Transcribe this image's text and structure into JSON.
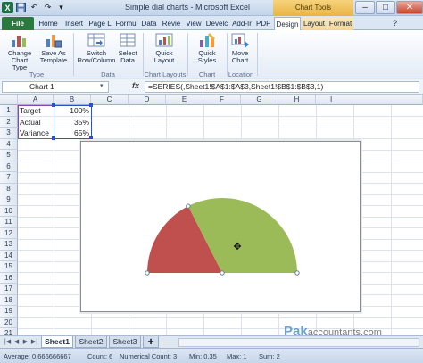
{
  "window": {
    "title": "Simple dial charts - Microsoft Excel",
    "context_group": "Chart Tools",
    "minimize": "–",
    "maximize": "□",
    "close": "✕"
  },
  "tabs": [
    {
      "label": "File"
    },
    {
      "label": "Home"
    },
    {
      "label": "Insert"
    },
    {
      "label": "Page L"
    },
    {
      "label": "Formu"
    },
    {
      "label": "Data"
    },
    {
      "label": "Revie"
    },
    {
      "label": "View"
    },
    {
      "label": "Develc"
    },
    {
      "label": "Add-Ir"
    },
    {
      "label": "PDF"
    },
    {
      "label": "Design"
    },
    {
      "label": "Layout"
    },
    {
      "label": "Format"
    }
  ],
  "ribbon": {
    "buttons": {
      "change_chart_type": "Change Chart Type",
      "save_as_template": "Save As Template",
      "switch_row_column": "Switch Row/Column",
      "select_data": "Select Data",
      "quick_layout": "Quick Layout",
      "quick_styles": "Quick Styles",
      "move_chart": "Move Chart"
    },
    "groups": {
      "type": "Type",
      "data": "Data",
      "chart_layouts": "Chart Layouts",
      "chart_styles": "Chart Styles",
      "location": "Location"
    }
  },
  "formula_bar": {
    "name_box": "Chart 1",
    "fx": "fx",
    "formula": "=SERIES(,Sheet1!$A$1:$A$3,Sheet1!$B$1:$B$3,1)"
  },
  "columns": [
    "A",
    "B",
    "C",
    "D",
    "E",
    "F",
    "G",
    "H",
    "I"
  ],
  "rows": [
    "1",
    "2",
    "3",
    "4",
    "5",
    "6",
    "7",
    "8",
    "9",
    "10",
    "11",
    "12",
    "13",
    "14",
    "15",
    "16",
    "17",
    "18",
    "19",
    "20",
    "21"
  ],
  "cells": [
    {
      "label": "Target",
      "value": "100%"
    },
    {
      "label": "Actual",
      "value": "35%"
    },
    {
      "label": "Variance",
      "value": "65%"
    }
  ],
  "chart_data": {
    "type": "pie",
    "categories": [
      "Target",
      "Actual",
      "Variance"
    ],
    "values": [
      100,
      35,
      65
    ],
    "visible_slices": [
      "Actual",
      "Variance"
    ],
    "hidden_slice": "Target",
    "colors": {
      "Target": "none",
      "Actual": "#c0504d",
      "Variance": "#9bbb59"
    },
    "title": "",
    "legend": "none"
  },
  "sheets": [
    "Sheet1",
    "Sheet2",
    "Sheet3"
  ],
  "status": {
    "average": "Average: 0.666666667",
    "count": "Count: 6",
    "numerical_count": "Numerical Count: 3",
    "min": "Min: 0.35",
    "max": "Max: 1",
    "sum": "Sum: 2"
  },
  "watermark": {
    "brand": "Pak",
    "suffix": "accountants.com"
  }
}
